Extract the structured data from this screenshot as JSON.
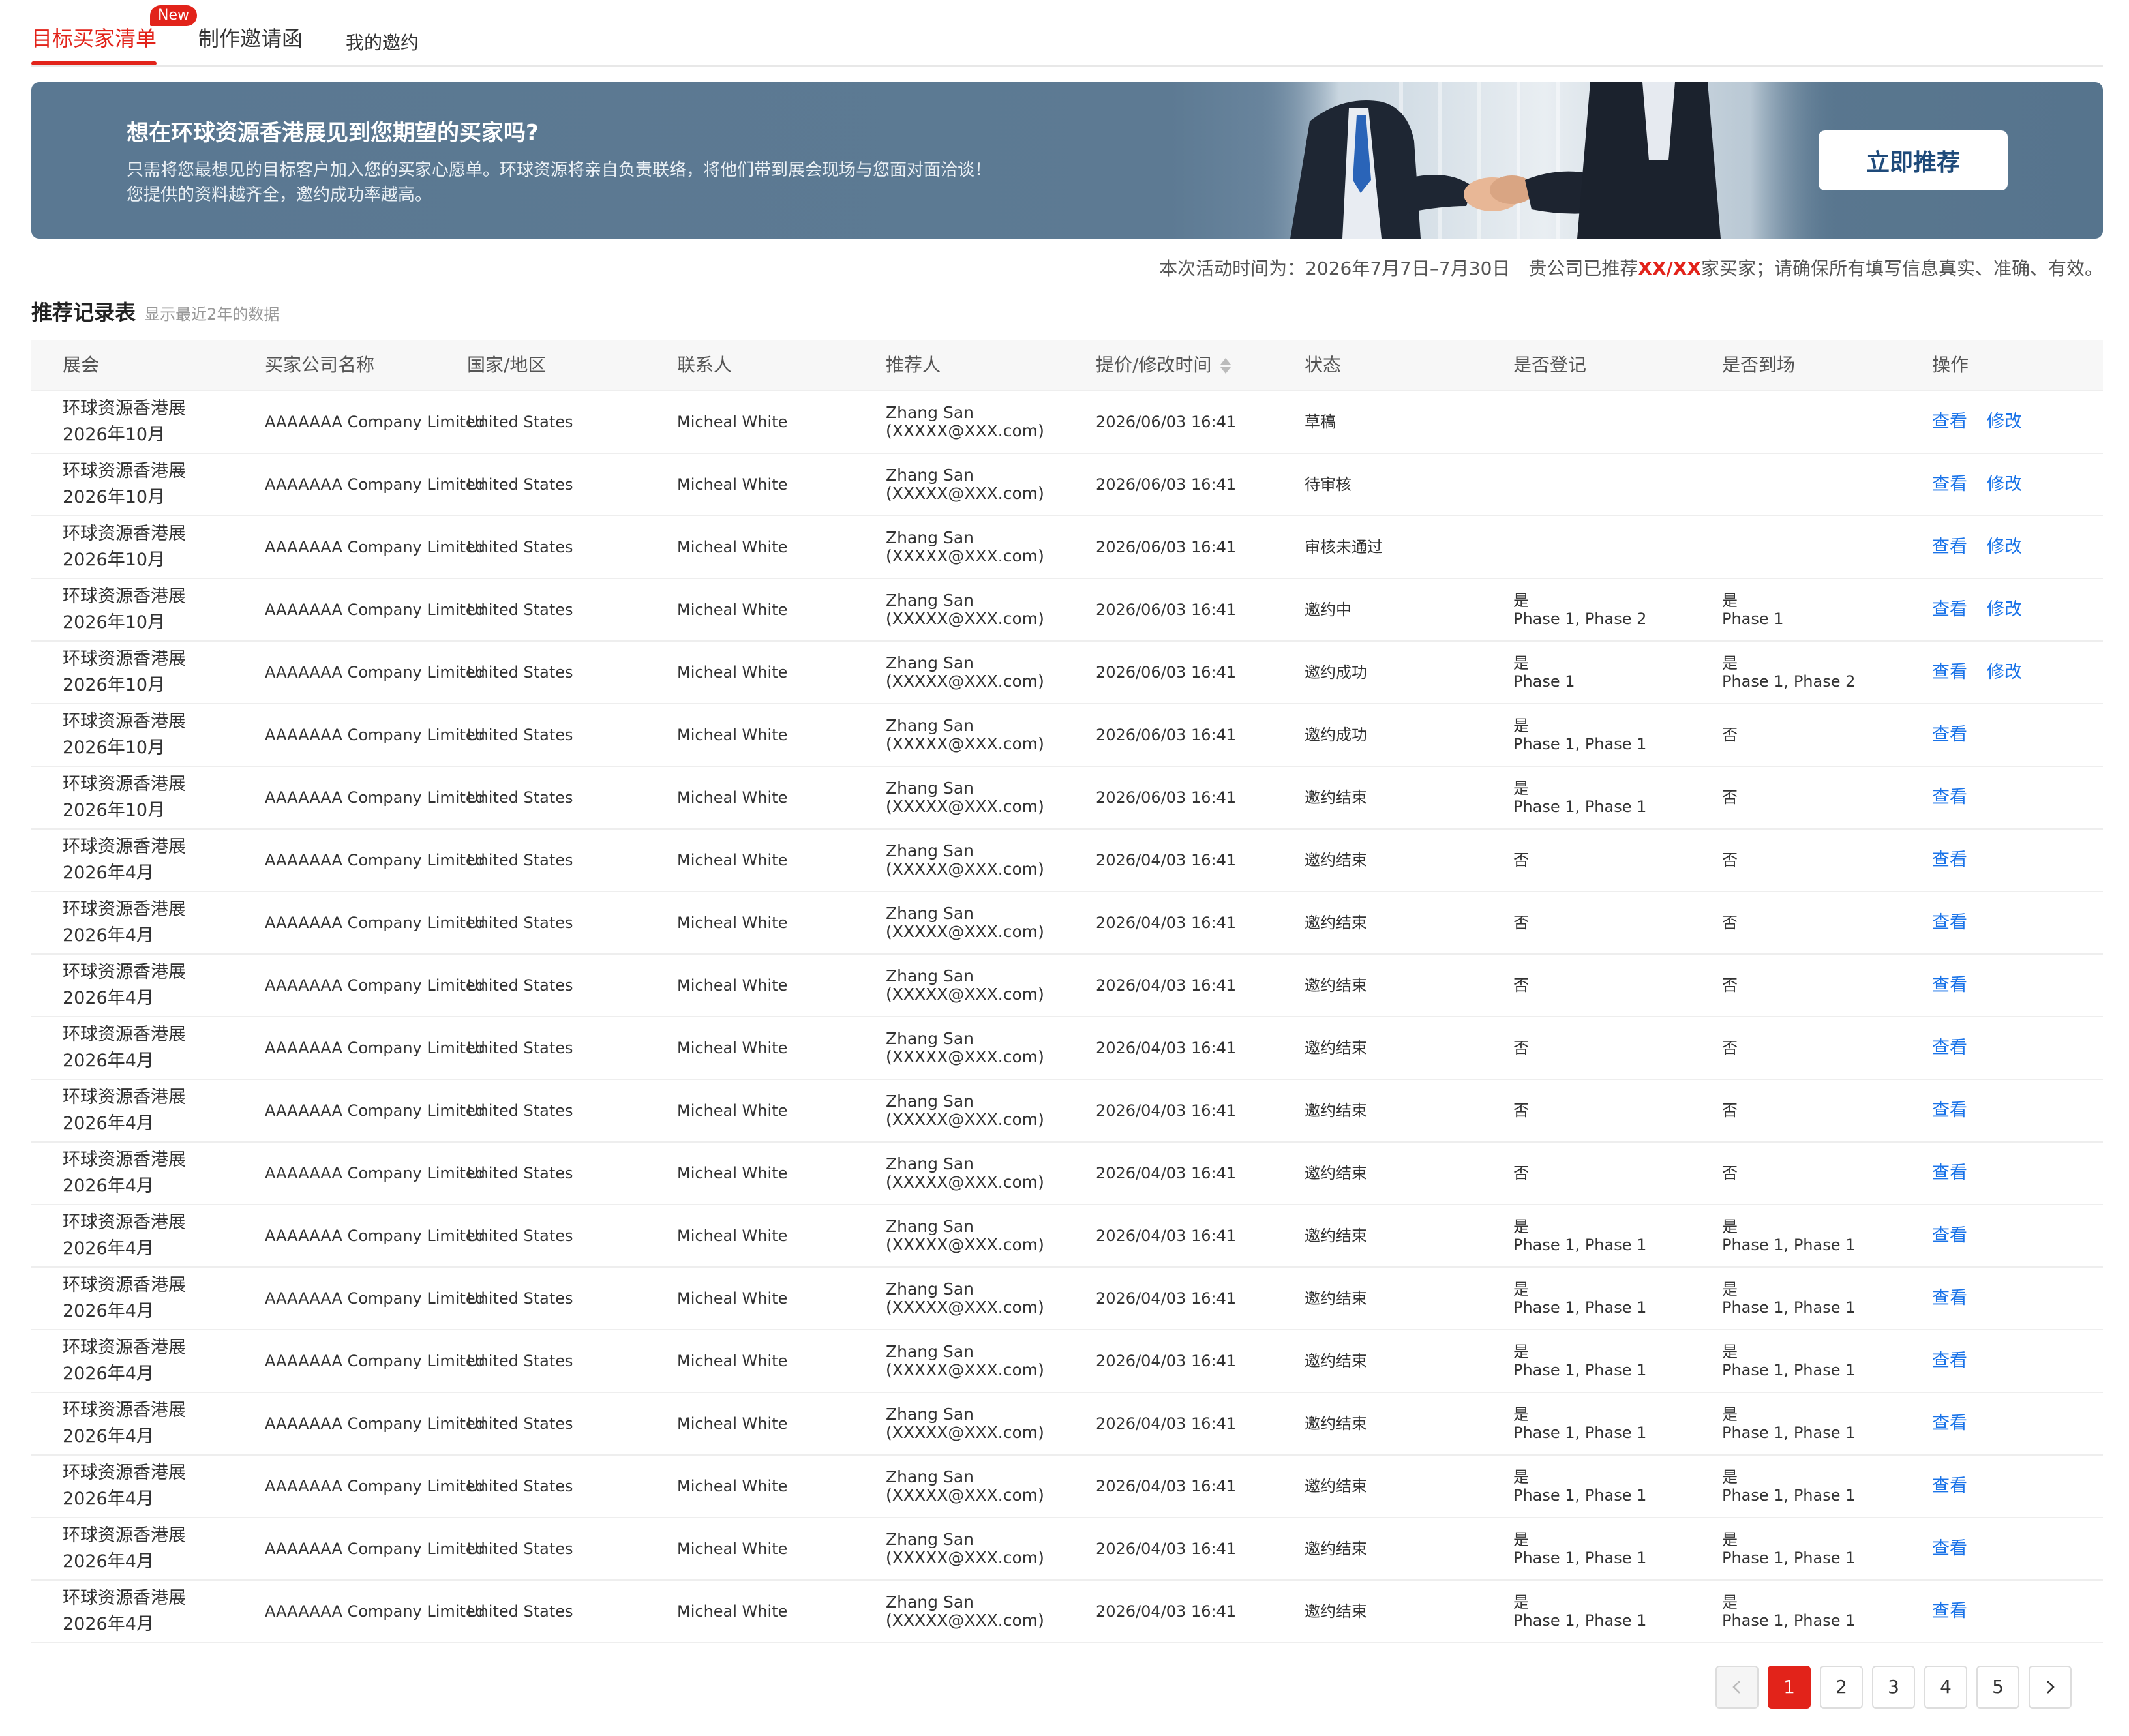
{
  "tabs": [
    {
      "label": "目标买家清单",
      "badge": "New"
    },
    {
      "label": "制作邀请函"
    },
    {
      "label": "我的邀约"
    }
  ],
  "banner": {
    "title": "想在环球资源香港展见到您期望的买家吗?",
    "desc": "只需将您最想见的目标客户加入您的买家心愿单。环球资源将亲自负责联络，将他们带到展会现场与您面对面洽谈！您提供的资料越齐全，邀约成功率越高。",
    "button": "立即推荐",
    "image_icon": "handshake-photo"
  },
  "notice": {
    "prefix": "本次活动时间为：2026年7月7日–7月30日　贵公司已推荐",
    "count": "XX/XX",
    "suffix": "家买家；请确保所有填写信息真实、准确、有效。"
  },
  "section": {
    "title": "推荐记录表",
    "subtitle": "显示最近2年的数据"
  },
  "table": {
    "headers": {
      "fair": "展会",
      "company": "买家公司名称",
      "country": "国家/地区",
      "contact": "联系人",
      "referrer": "推荐人",
      "time": "提价/修改时间",
      "status": "状态",
      "registered": "是否登记",
      "arrived": "是否到场",
      "ops": "操作"
    },
    "op_view": "查看",
    "op_edit": "修改",
    "rows": [
      {
        "fair1": "环球资源香港展",
        "fair2": "2026年10月",
        "company": "AAAAAAA Company Limited",
        "country": "United States",
        "contact": "Micheal White",
        "ref1": "Zhang San",
        "ref2": "(XXXXX@XXX.com)",
        "time": "2026/06/03 16:41",
        "status": "草稿",
        "reg1": "",
        "reg2": "",
        "arr1": "",
        "arr2": "",
        "edit": true
      },
      {
        "fair1": "环球资源香港展",
        "fair2": "2026年10月",
        "company": "AAAAAAA Company Limited",
        "country": "United States",
        "contact": "Micheal White",
        "ref1": "Zhang San",
        "ref2": "(XXXXX@XXX.com)",
        "time": "2026/06/03 16:41",
        "status": "待审核",
        "reg1": "",
        "reg2": "",
        "arr1": "",
        "arr2": "",
        "edit": true
      },
      {
        "fair1": "环球资源香港展",
        "fair2": "2026年10月",
        "company": "AAAAAAA Company Limited",
        "country": "United States",
        "contact": "Micheal White",
        "ref1": "Zhang San",
        "ref2": "(XXXXX@XXX.com)",
        "time": "2026/06/03 16:41",
        "status": "审核未通过",
        "reg1": "",
        "reg2": "",
        "arr1": "",
        "arr2": "",
        "edit": true
      },
      {
        "fair1": "环球资源香港展",
        "fair2": "2026年10月",
        "company": "AAAAAAA Company Limited",
        "country": "United States",
        "contact": "Micheal White",
        "ref1": "Zhang San",
        "ref2": "(XXXXX@XXX.com)",
        "time": "2026/06/03 16:41",
        "status": "邀约中",
        "reg1": "是",
        "reg2": "Phase 1, Phase 2",
        "arr1": "是",
        "arr2": "Phase 1",
        "edit": true
      },
      {
        "fair1": "环球资源香港展",
        "fair2": "2026年10月",
        "company": "AAAAAAA Company Limited",
        "country": "United States",
        "contact": "Micheal White",
        "ref1": "Zhang San",
        "ref2": "(XXXXX@XXX.com)",
        "time": "2026/06/03 16:41",
        "status": "邀约成功",
        "reg1": "是",
        "reg2": "Phase 1",
        "arr1": "是",
        "arr2": "Phase 1, Phase 2",
        "edit": true
      },
      {
        "fair1": "环球资源香港展",
        "fair2": "2026年10月",
        "company": "AAAAAAA Company Limited",
        "country": "United States",
        "contact": "Micheal White",
        "ref1": "Zhang San",
        "ref2": "(XXXXX@XXX.com)",
        "time": "2026/06/03 16:41",
        "status": "邀约成功",
        "reg1": "是",
        "reg2": "Phase 1, Phase 1",
        "arr1": "否",
        "arr2": "",
        "edit": false
      },
      {
        "fair1": "环球资源香港展",
        "fair2": "2026年10月",
        "company": "AAAAAAA Company Limited",
        "country": "United States",
        "contact": "Micheal White",
        "ref1": "Zhang San",
        "ref2": "(XXXXX@XXX.com)",
        "time": "2026/06/03 16:41",
        "status": "邀约结束",
        "reg1": "是",
        "reg2": "Phase 1, Phase 1",
        "arr1": "否",
        "arr2": "",
        "edit": false
      },
      {
        "fair1": "环球资源香港展",
        "fair2": "2026年4月",
        "company": "AAAAAAA Company Limited",
        "country": "United States",
        "contact": "Micheal White",
        "ref1": "Zhang San",
        "ref2": "(XXXXX@XXX.com)",
        "time": "2026/04/03 16:41",
        "status": "邀约结束",
        "reg1": "否",
        "reg2": "",
        "arr1": "否",
        "arr2": "",
        "edit": false
      },
      {
        "fair1": "环球资源香港展",
        "fair2": "2026年4月",
        "company": "AAAAAAA Company Limited",
        "country": "United States",
        "contact": "Micheal White",
        "ref1": "Zhang San",
        "ref2": "(XXXXX@XXX.com)",
        "time": "2026/04/03 16:41",
        "status": "邀约结束",
        "reg1": "否",
        "reg2": "",
        "arr1": "否",
        "arr2": "",
        "edit": false
      },
      {
        "fair1": "环球资源香港展",
        "fair2": "2026年4月",
        "company": "AAAAAAA Company Limited",
        "country": "United States",
        "contact": "Micheal White",
        "ref1": "Zhang San",
        "ref2": "(XXXXX@XXX.com)",
        "time": "2026/04/03 16:41",
        "status": "邀约结束",
        "reg1": "否",
        "reg2": "",
        "arr1": "否",
        "arr2": "",
        "edit": false
      },
      {
        "fair1": "环球资源香港展",
        "fair2": "2026年4月",
        "company": "AAAAAAA Company Limited",
        "country": "United States",
        "contact": "Micheal White",
        "ref1": "Zhang San",
        "ref2": "(XXXXX@XXX.com)",
        "time": "2026/04/03 16:41",
        "status": "邀约结束",
        "reg1": "否",
        "reg2": "",
        "arr1": "否",
        "arr2": "",
        "edit": false
      },
      {
        "fair1": "环球资源香港展",
        "fair2": "2026年4月",
        "company": "AAAAAAA Company Limited",
        "country": "United States",
        "contact": "Micheal White",
        "ref1": "Zhang San",
        "ref2": "(XXXXX@XXX.com)",
        "time": "2026/04/03 16:41",
        "status": "邀约结束",
        "reg1": "否",
        "reg2": "",
        "arr1": "否",
        "arr2": "",
        "edit": false
      },
      {
        "fair1": "环球资源香港展",
        "fair2": "2026年4月",
        "company": "AAAAAAA Company Limited",
        "country": "United States",
        "contact": "Micheal White",
        "ref1": "Zhang San",
        "ref2": "(XXXXX@XXX.com)",
        "time": "2026/04/03 16:41",
        "status": "邀约结束",
        "reg1": "否",
        "reg2": "",
        "arr1": "否",
        "arr2": "",
        "edit": false
      },
      {
        "fair1": "环球资源香港展",
        "fair2": "2026年4月",
        "company": "AAAAAAA Company Limited",
        "country": "United States",
        "contact": "Micheal White",
        "ref1": "Zhang San",
        "ref2": "(XXXXX@XXX.com)",
        "time": "2026/04/03 16:41",
        "status": "邀约结束",
        "reg1": "是",
        "reg2": "Phase 1, Phase 1",
        "arr1": "是",
        "arr2": "Phase 1, Phase 1",
        "edit": false
      },
      {
        "fair1": "环球资源香港展",
        "fair2": "2026年4月",
        "company": "AAAAAAA Company Limited",
        "country": "United States",
        "contact": "Micheal White",
        "ref1": "Zhang San",
        "ref2": "(XXXXX@XXX.com)",
        "time": "2026/04/03 16:41",
        "status": "邀约结束",
        "reg1": "是",
        "reg2": "Phase 1, Phase 1",
        "arr1": "是",
        "arr2": "Phase 1, Phase 1",
        "edit": false
      },
      {
        "fair1": "环球资源香港展",
        "fair2": "2026年4月",
        "company": "AAAAAAA Company Limited",
        "country": "United States",
        "contact": "Micheal White",
        "ref1": "Zhang San",
        "ref2": "(XXXXX@XXX.com)",
        "time": "2026/04/03 16:41",
        "status": "邀约结束",
        "reg1": "是",
        "reg2": "Phase 1, Phase 1",
        "arr1": "是",
        "arr2": "Phase 1, Phase 1",
        "edit": false
      },
      {
        "fair1": "环球资源香港展",
        "fair2": "2026年4月",
        "company": "AAAAAAA Company Limited",
        "country": "United States",
        "contact": "Micheal White",
        "ref1": "Zhang San",
        "ref2": "(XXXXX@XXX.com)",
        "time": "2026/04/03 16:41",
        "status": "邀约结束",
        "reg1": "是",
        "reg2": "Phase 1, Phase 1",
        "arr1": "是",
        "arr2": "Phase 1, Phase 1",
        "edit": false
      },
      {
        "fair1": "环球资源香港展",
        "fair2": "2026年4月",
        "company": "AAAAAAA Company Limited",
        "country": "United States",
        "contact": "Micheal White",
        "ref1": "Zhang San",
        "ref2": "(XXXXX@XXX.com)",
        "time": "2026/04/03 16:41",
        "status": "邀约结束",
        "reg1": "是",
        "reg2": "Phase 1, Phase 1",
        "arr1": "是",
        "arr2": "Phase 1, Phase 1",
        "edit": false
      },
      {
        "fair1": "环球资源香港展",
        "fair2": "2026年4月",
        "company": "AAAAAAA Company Limited",
        "country": "United States",
        "contact": "Micheal White",
        "ref1": "Zhang San",
        "ref2": "(XXXXX@XXX.com)",
        "time": "2026/04/03 16:41",
        "status": "邀约结束",
        "reg1": "是",
        "reg2": "Phase 1, Phase 1",
        "arr1": "是",
        "arr2": "Phase 1, Phase 1",
        "edit": false
      },
      {
        "fair1": "环球资源香港展",
        "fair2": "2026年4月",
        "company": "AAAAAAA Company Limited",
        "country": "United States",
        "contact": "Micheal White",
        "ref1": "Zhang San",
        "ref2": "(XXXXX@XXX.com)",
        "time": "2026/04/03 16:41",
        "status": "邀约结束",
        "reg1": "是",
        "reg2": "Phase 1, Phase 1",
        "arr1": "是",
        "arr2": "Phase 1, Phase 1",
        "edit": false
      }
    ]
  },
  "pagination": {
    "pages": [
      "1",
      "2",
      "3",
      "4",
      "5"
    ],
    "current": "1",
    "prev_icon": "chevron-left-icon",
    "next_icon": "chevron-right-icon"
  },
  "colors": {
    "accent": "#e2231a",
    "link": "#1a73e8",
    "banner_bg": "#5a7892",
    "banner_button_text": "#1e4a7a"
  }
}
